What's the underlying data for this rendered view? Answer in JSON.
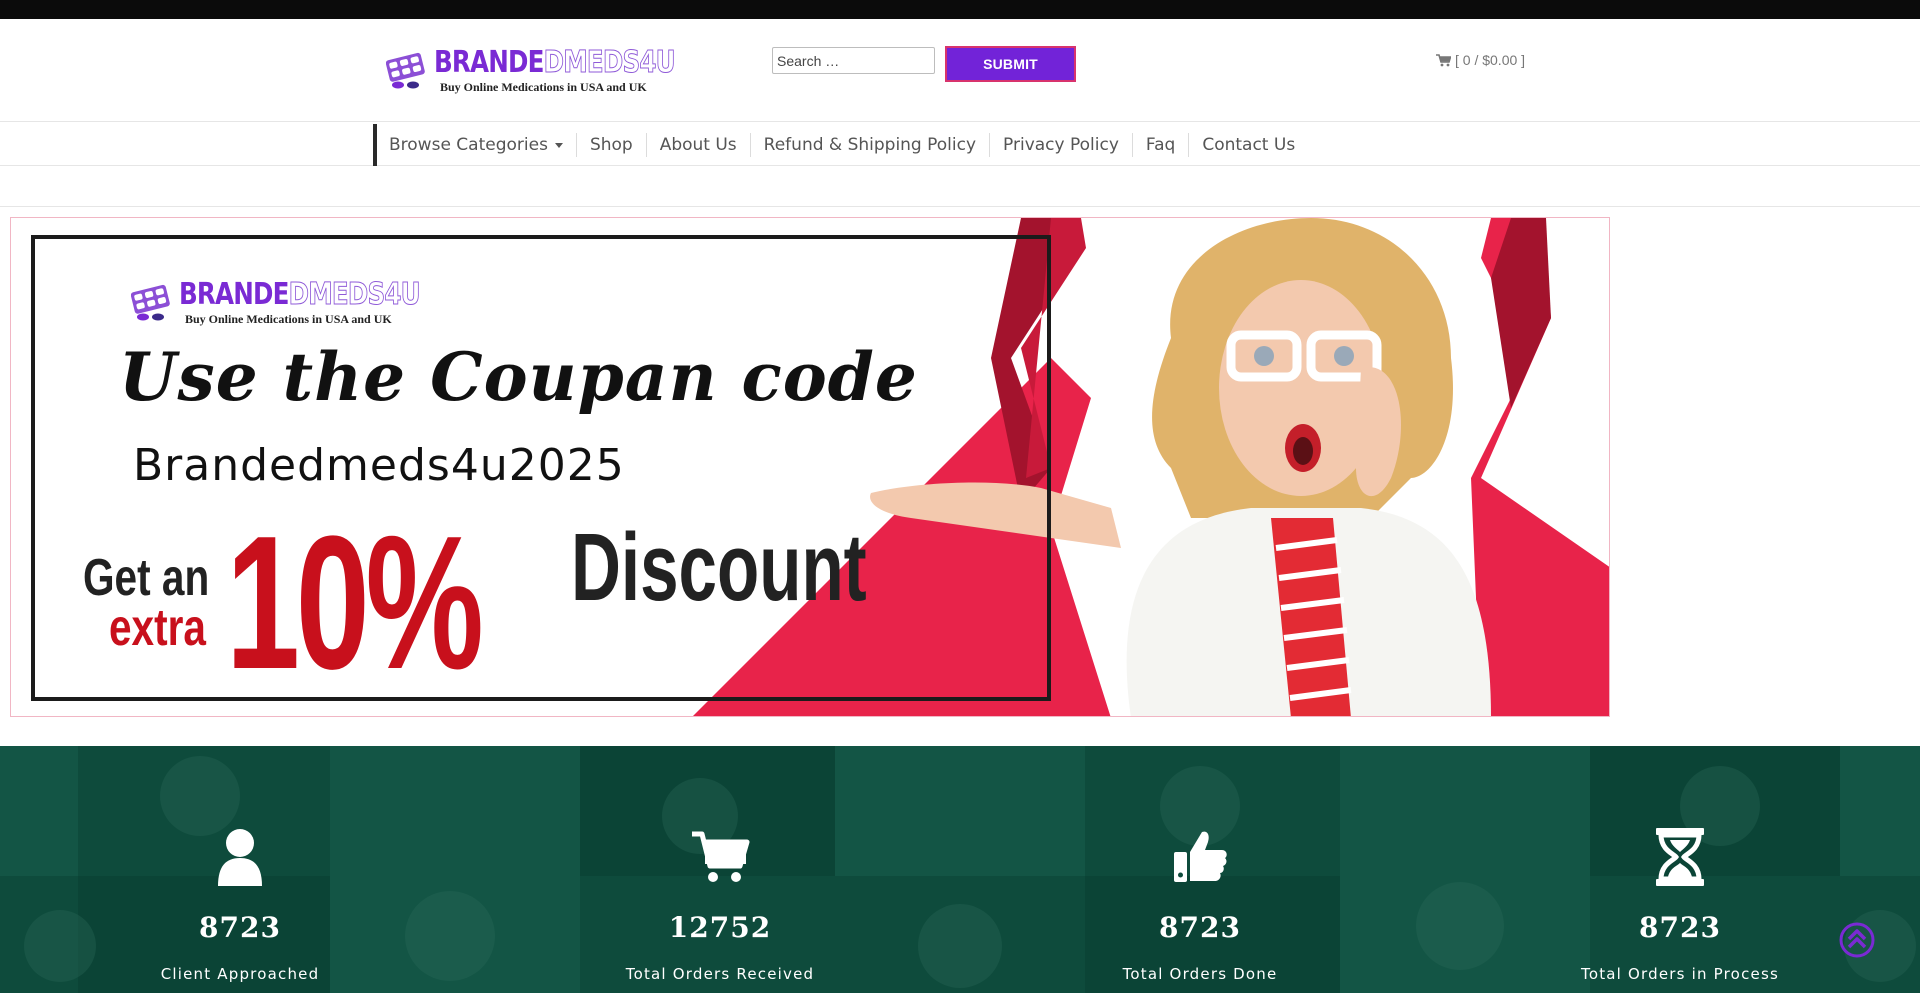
{
  "header": {
    "logo": {
      "word_part1": "BRANDE",
      "word_part2": "DMEDS4U",
      "tagline": "Buy Online Medications in USA and UK"
    },
    "search": {
      "placeholder": "Search …"
    },
    "submit_label": "SUBMIT",
    "cart": {
      "icon": "shopping-cart-icon",
      "text": "[ 0 / $0.00 ]"
    }
  },
  "nav": {
    "items": [
      {
        "label": "Browse Categories",
        "has_dropdown": true
      },
      {
        "label": "Shop"
      },
      {
        "label": "About Us"
      },
      {
        "label": "Refund & Shipping Policy"
      },
      {
        "label": "Privacy Policy"
      },
      {
        "label": "Faq"
      },
      {
        "label": "Contact Us"
      }
    ]
  },
  "banner": {
    "logo_word_part1": "BRANDE",
    "logo_word_part2": "DMEDS4U",
    "logo_tagline": "Buy Online Medications in USA and UK",
    "headline": "Use the Coupan code",
    "code": "Brandedmeds4u2025",
    "get_an": "Get an",
    "extra": "extra",
    "percent": "10%",
    "discount": "Discount"
  },
  "stats": [
    {
      "icon": "user-icon",
      "value": "8723",
      "label": "Client Approached"
    },
    {
      "icon": "cart-icon",
      "value": "12752",
      "label": "Total Orders Received"
    },
    {
      "icon": "thumbs-up-icon",
      "value": "8723",
      "label": "Total Orders Done"
    },
    {
      "icon": "hourglass-icon",
      "value": "8723",
      "label": "Total Orders in Process"
    }
  ],
  "colors": {
    "brand_purple": "#7223d8",
    "submit_border": "#d8336d",
    "stats_bg": "#0e4b3c",
    "banner_red": "#c8101c",
    "ribbon": "#e8234a"
  },
  "scroll_to_top": {
    "icon": "chevron-up-circle-icon"
  }
}
